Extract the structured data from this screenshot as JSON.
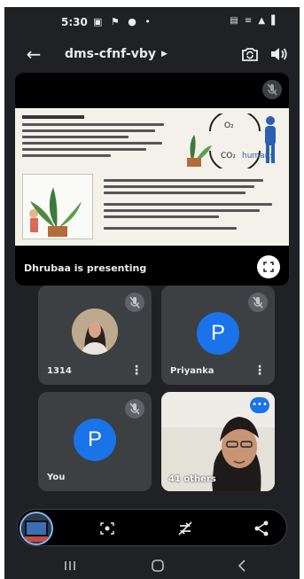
{
  "status": {
    "time": "5:30",
    "left_icons": "▣ ⚑ ● •",
    "right_icons": "▤ ≡ ▲ ▌"
  },
  "topbar": {
    "meeting_code": "dms-cfnf-vby",
    "code_arrow": "▶"
  },
  "presentation": {
    "presenter_label": "Dhrubaa is presenting",
    "slide_co2_label": "CO₂",
    "slide_o2_label": "O₂",
    "slide_humans_label": "humans"
  },
  "participants": [
    {
      "name": "1314",
      "initial": ""
    },
    {
      "name": "Priyanka",
      "initial": "P"
    },
    {
      "name": "You",
      "initial": "P"
    }
  ],
  "video_tile": {
    "others_label": "41 others",
    "badge": "•••"
  },
  "colors": {
    "background": "#202124",
    "tile": "#3c4043",
    "accent": "#1a73e8"
  }
}
